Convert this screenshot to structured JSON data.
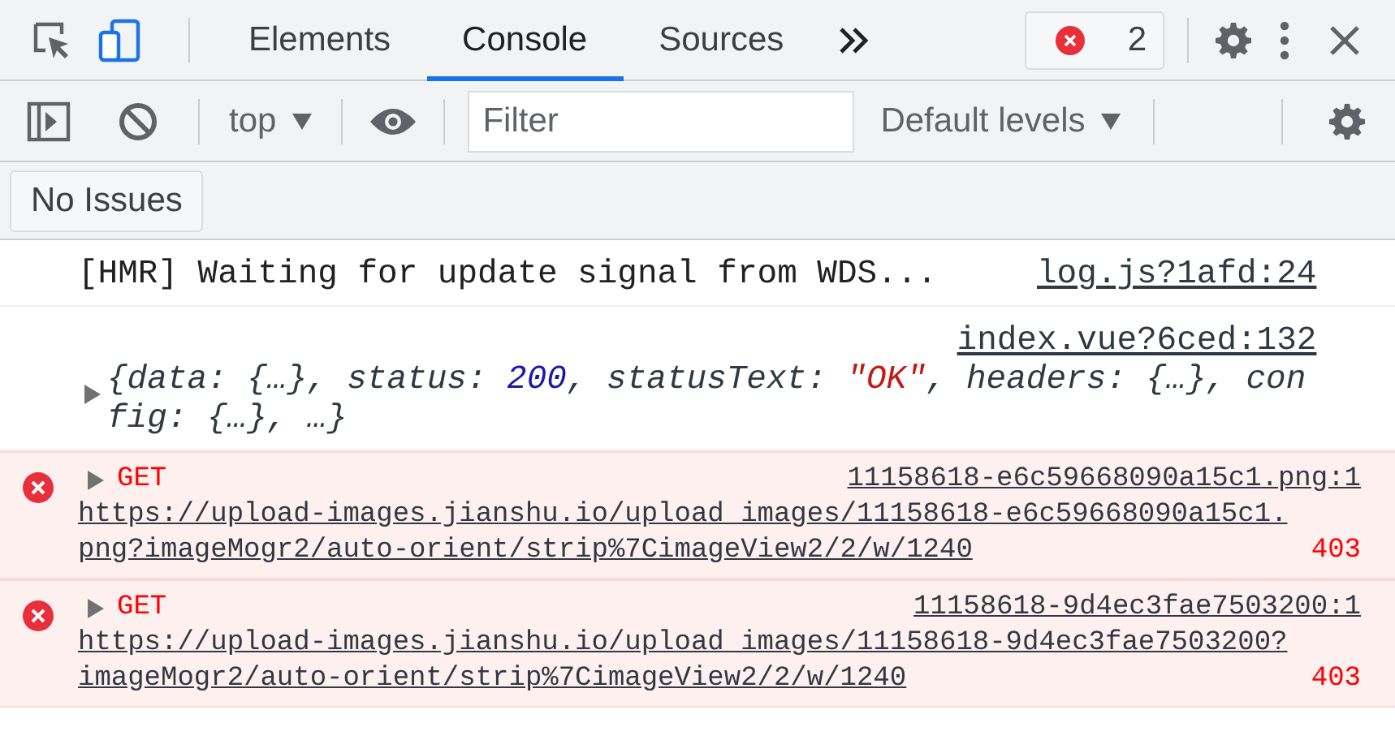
{
  "main_toolbar": {
    "tabs": [
      {
        "label": "Elements",
        "selected": false
      },
      {
        "label": "Console",
        "selected": true
      },
      {
        "label": "Sources",
        "selected": false
      }
    ],
    "error_count": "2"
  },
  "console_toolbar": {
    "context": "top",
    "filter": {
      "placeholder": "Filter"
    },
    "levels": "Default levels"
  },
  "issues_button": "No Issues",
  "messages": [
    {
      "kind": "log",
      "text": "[HMR] Waiting for update signal from WDS...",
      "source": "log.js?1afd:24"
    },
    {
      "kind": "object",
      "source": "index.vue?6ced:132",
      "expanded": false,
      "segments": [
        {
          "kind": "plain",
          "text": "{data: {…}, status: "
        },
        {
          "kind": "number",
          "text": "200"
        },
        {
          "kind": "plain",
          "text": ", statusText: "
        },
        {
          "kind": "string",
          "text": "\"OK\""
        },
        {
          "kind": "plain",
          "text": ", headers: {…}, config: {…}, …}"
        }
      ]
    },
    {
      "kind": "error",
      "expanded": false,
      "method": "GET",
      "url": "https://upload-images.jianshu.io/upload_images/11158618-e6c59668090a15c1.png?imageMogr2/auto-orient/strip%7CimageView2/2/w/1240",
      "source": "11158618-e6c59668090a15c1.png:1",
      "status": "403"
    },
    {
      "kind": "error",
      "expanded": false,
      "method": "GET",
      "url": "https://upload-images.jianshu.io/upload_images/11158618-9d4ec3fae7503200?imageMogr2/auto-orient/strip%7CimageView2/2/w/1240",
      "source": "11158618-9d4ec3fae7503200:1",
      "status": "403"
    }
  ]
}
